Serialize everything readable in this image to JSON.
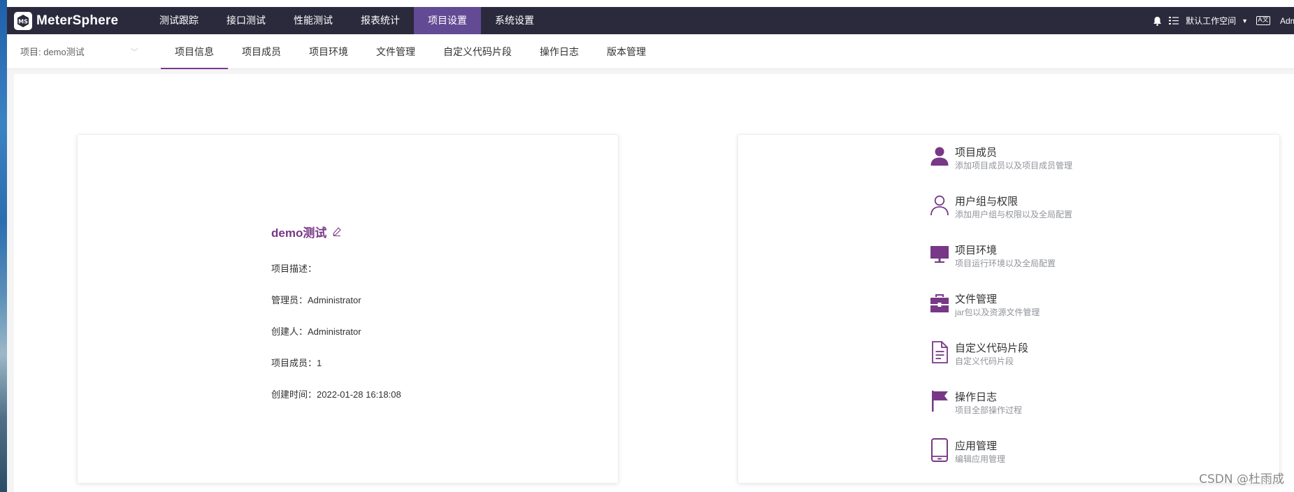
{
  "app": {
    "name": "MeterSphere"
  },
  "topnav": {
    "items": [
      {
        "label": "测试跟踪"
      },
      {
        "label": "接口测试"
      },
      {
        "label": "性能测试"
      },
      {
        "label": "报表统计"
      },
      {
        "label": "项目设置",
        "active": true
      },
      {
        "label": "系统设置"
      }
    ]
  },
  "topright": {
    "workspace": "默认工作空间",
    "user": "Administrator"
  },
  "project_selector": {
    "label": "项目: demo测试"
  },
  "subtabs": [
    {
      "label": "项目信息",
      "active": true
    },
    {
      "label": "项目成员"
    },
    {
      "label": "项目环境"
    },
    {
      "label": "文件管理"
    },
    {
      "label": "自定义代码片段"
    },
    {
      "label": "操作日志"
    },
    {
      "label": "版本管理"
    }
  ],
  "project": {
    "name": "demo测试",
    "description": "项目描述：",
    "admin": "管理员：Administrator",
    "creator": "创建人：Administrator",
    "members": "项目成员：1",
    "created": "创建时间：2022-01-28 16:18:08"
  },
  "features": [
    {
      "title": "项目成员",
      "desc": "添加项目成员以及项目成员管理",
      "icon": "user-filled-icon"
    },
    {
      "title": "用户组与权限",
      "desc": "添加用户组与权限以及全局配置",
      "icon": "user-outline-icon"
    },
    {
      "title": "项目环境",
      "desc": "项目运行环境以及全局配置",
      "icon": "monitor-icon"
    },
    {
      "title": "文件管理",
      "desc": "jar包以及资源文件管理",
      "icon": "briefcase-icon"
    },
    {
      "title": "自定义代码片段",
      "desc": "自定义代码片段",
      "icon": "document-icon"
    },
    {
      "title": "操作日志",
      "desc": "项目全部操作过程",
      "icon": "flag-icon"
    },
    {
      "title": "应用管理",
      "desc": "编辑应用管理",
      "icon": "tablet-icon"
    }
  ],
  "watermark": "CSDN @杜雨成",
  "colors": {
    "header": "#2b2a3d",
    "accent": "#783887",
    "active_nav": "#634a94"
  }
}
